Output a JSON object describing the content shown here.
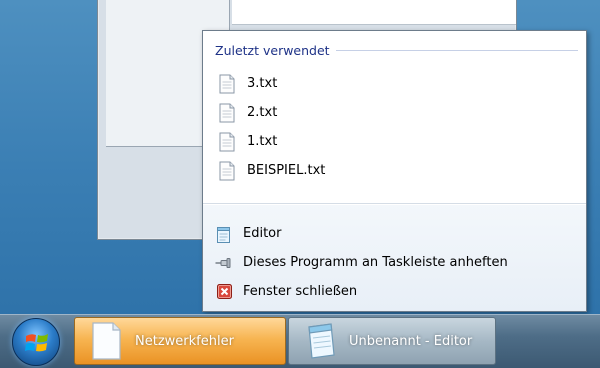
{
  "jumplist": {
    "section_title": "Zuletzt verwendet",
    "recent_items": [
      {
        "label": "3.txt",
        "icon": "text-file-icon"
      },
      {
        "label": "2.txt",
        "icon": "text-file-icon"
      },
      {
        "label": "1.txt",
        "icon": "text-file-icon"
      },
      {
        "label": "BEISPIEL.txt",
        "icon": "text-file-icon"
      }
    ],
    "tasks": [
      {
        "label": "Editor",
        "icon": "notepad-icon"
      },
      {
        "label": "Dieses Programm an Taskleiste anheften",
        "icon": "pin-icon"
      },
      {
        "label": "Fenster schließen",
        "icon": "close-window-icon"
      }
    ]
  },
  "taskbar": {
    "buttons": [
      {
        "label": "Netzwerkfehler",
        "icon": "document-icon",
        "state": "highlighted"
      },
      {
        "label": "Unbenannt - Editor",
        "icon": "notepad-icon",
        "state": "normal"
      }
    ],
    "start_icon": "windows-start-orb-icon"
  },
  "colors": {
    "section_title": "#1e3287",
    "highlight_button": "#f7b552"
  }
}
